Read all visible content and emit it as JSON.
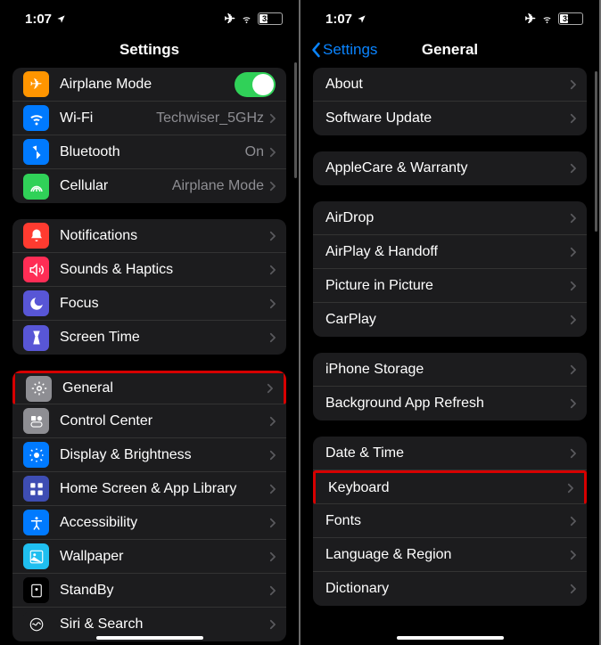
{
  "left": {
    "time": "1:07",
    "battery": "32",
    "title": "Settings",
    "items": [
      {
        "id": "airplane",
        "label": "Airplane Mode",
        "iconColor": "#ff9500",
        "iconGlyph": "✈",
        "toggle": true
      },
      {
        "id": "wifi",
        "label": "Wi-Fi",
        "value": "Techwiser_5GHz",
        "iconColor": "#007aff",
        "iconGlyph": "wifi"
      },
      {
        "id": "bluetooth",
        "label": "Bluetooth",
        "value": "On",
        "iconColor": "#007aff",
        "iconGlyph": "bt"
      },
      {
        "id": "cellular",
        "label": "Cellular",
        "value": "Airplane Mode",
        "iconColor": "#30d158",
        "iconGlyph": "ant"
      },
      {
        "id": "notifications",
        "label": "Notifications",
        "iconColor": "#ff3b30",
        "iconGlyph": "bell"
      },
      {
        "id": "sounds",
        "label": "Sounds & Haptics",
        "iconColor": "#ff2d55",
        "iconGlyph": "vol"
      },
      {
        "id": "focus",
        "label": "Focus",
        "iconColor": "#5856d6",
        "iconGlyph": "moon"
      },
      {
        "id": "screentime",
        "label": "Screen Time",
        "iconColor": "#5856d6",
        "iconGlyph": "hour"
      },
      {
        "id": "general",
        "label": "General",
        "iconColor": "#8e8e93",
        "iconGlyph": "gear",
        "highlight": true
      },
      {
        "id": "control",
        "label": "Control Center",
        "iconColor": "#8e8e93",
        "iconGlyph": "switch"
      },
      {
        "id": "display",
        "label": "Display & Brightness",
        "iconColor": "#007aff",
        "iconGlyph": "sun"
      },
      {
        "id": "home",
        "label": "Home Screen & App Library",
        "iconColor": "#3e4db3",
        "iconGlyph": "grid"
      },
      {
        "id": "accessibility",
        "label": "Accessibility",
        "iconColor": "#007aff",
        "iconGlyph": "acc"
      },
      {
        "id": "wallpaper",
        "label": "Wallpaper",
        "iconColor": "#1fbff0",
        "iconGlyph": "wall"
      },
      {
        "id": "standby",
        "label": "StandBy",
        "iconColor": "#000",
        "iconGlyph": "stand"
      },
      {
        "id": "siri",
        "label": "Siri & Search",
        "iconColor": "#1c1c1e",
        "iconGlyph": "siri"
      }
    ]
  },
  "right": {
    "time": "1:07",
    "battery": "33",
    "backLabel": "Settings",
    "title": "General",
    "groups": [
      [
        {
          "id": "about",
          "label": "About"
        },
        {
          "id": "update",
          "label": "Software Update"
        }
      ],
      [
        {
          "id": "applecare",
          "label": "AppleCare & Warranty"
        }
      ],
      [
        {
          "id": "airdrop",
          "label": "AirDrop"
        },
        {
          "id": "airplay",
          "label": "AirPlay & Handoff"
        },
        {
          "id": "pip",
          "label": "Picture in Picture"
        },
        {
          "id": "carplay",
          "label": "CarPlay"
        }
      ],
      [
        {
          "id": "storage",
          "label": "iPhone Storage"
        },
        {
          "id": "bgrefresh",
          "label": "Background App Refresh"
        }
      ],
      [
        {
          "id": "datetime",
          "label": "Date & Time"
        },
        {
          "id": "keyboard",
          "label": "Keyboard",
          "highlight": true
        },
        {
          "id": "fonts",
          "label": "Fonts"
        },
        {
          "id": "language",
          "label": "Language & Region"
        },
        {
          "id": "dictionary",
          "label": "Dictionary"
        }
      ]
    ]
  }
}
